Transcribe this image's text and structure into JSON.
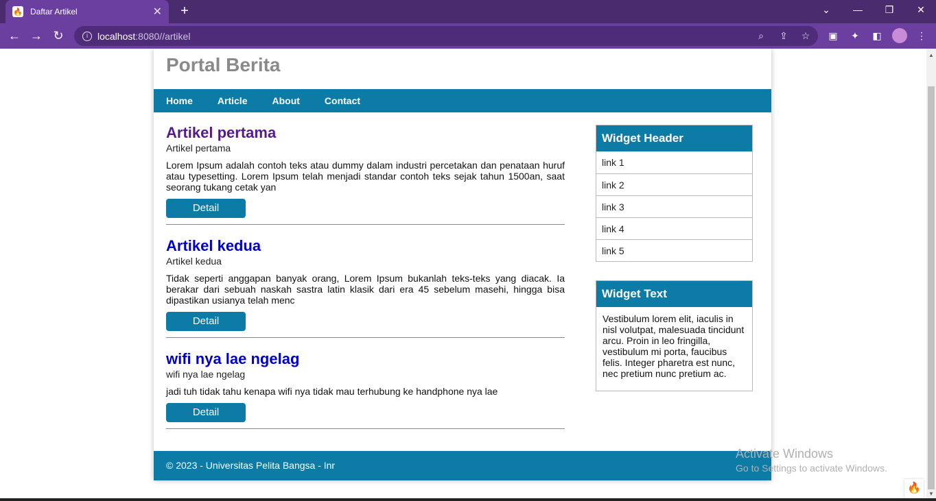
{
  "browser": {
    "tab_title": "Daftar Artikel",
    "tab_close": "✕",
    "new_tab": "+",
    "url_host": "localhost",
    "url_path": ":8080//artikel",
    "theme_color": "#6a3fa0"
  },
  "site": {
    "title": "Portal Berita",
    "accent_color": "#0c7ba6",
    "nav": [
      "Home",
      "Article",
      "About",
      "Contact"
    ]
  },
  "articles": [
    {
      "title": "Artikel pertama",
      "image_alt": "Artikel pertama",
      "excerpt": "Lorem Ipsum adalah contoh teks atau dummy dalam industri percetakan dan penataan huruf atau typesetting. Lorem Ipsum telah menjadi standar contoh teks sejak tahun 1500an, saat seorang tukang cetak yan",
      "button": "Detail"
    },
    {
      "title": "Artikel kedua",
      "image_alt": "Artikel kedua",
      "excerpt": "Tidak seperti anggapan banyak orang, Lorem Ipsum bukanlah teks-teks yang diacak. Ia berakar dari sebuah naskah sastra latin klasik dari era 45 sebelum masehi, hingga bisa dipastikan usianya telah menc",
      "button": "Detail"
    },
    {
      "title": "wifi nya lae ngelag",
      "image_alt": "wifi nya lae ngelag",
      "excerpt": "jadi tuh tidak tahu kenapa wifi nya tidak mau terhubung ke handphone nya lae",
      "button": "Detail"
    }
  ],
  "widgets": {
    "header_title": "Widget Header",
    "links": [
      "link 1",
      "link 2",
      "link 3",
      "link 4",
      "link 5"
    ],
    "text_title": "Widget Text",
    "text_body": "Vestibulum lorem elit, iaculis in nisl volutpat, malesuada tincidunt arcu. Proin in leo fringilla, vestibulum mi porta, faucibus felis. Integer pharetra est nunc, nec pretium nunc pretium ac."
  },
  "footer": {
    "text": "© 2023 - Universitas Pelita Bangsa - Inr"
  },
  "watermark": {
    "line1": "Activate Windows",
    "line2": "Go to Settings to activate Windows."
  }
}
